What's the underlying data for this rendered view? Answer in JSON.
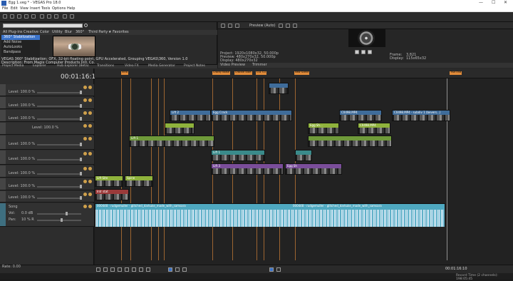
{
  "titlebar": {
    "title": "Egg 1.veg * - VEGAS Pro 18.0",
    "min": "—",
    "max": "☐",
    "close": "✕"
  },
  "menu": [
    "File",
    "Edit",
    "View",
    "Insert",
    "Tools",
    "Options",
    "Help"
  ],
  "explorer": {
    "tabs": [
      "All Plug-ins",
      "Creative",
      "Color",
      "Utility",
      "Blur",
      "360°",
      "Third Party",
      "★ Favorites"
    ],
    "items": [
      "360° Stabilization",
      "Add Noise",
      "AutoLooks",
      "Bandpass"
    ],
    "description_1": "VEGAS 360° Stabilization: OFX, 32-bit floating point, GPU Accelerated, Grouping VEGAS\\360, Version 1.0",
    "description_2": "Description: From Magix Computer Products Intl. Co."
  },
  "bottom_tabs": [
    "Project Media",
    "Explorer",
    "Hub Explorer (Beta)",
    "Transitions",
    "Video FX",
    "Media Generator",
    "Project Notes"
  ],
  "preview": {
    "mode": "Preview (Auto)",
    "project": "Project:  1920x1080x32, 50.000p",
    "preview_line": "Preview:  480x270x32, 50.000p",
    "display": "Display:  480x270x32",
    "frame_label": "Frame:",
    "frame_value": "3,821",
    "display_label": "Display:",
    "display_value": "115x65x32",
    "tabs": [
      "Video Preview",
      "Trimmer"
    ]
  },
  "timecode": "00:01:16:10",
  "tracks": [
    {
      "level": "Level: 100.0 %"
    },
    {
      "level": "Level: 100.0 %"
    },
    {
      "level": "Level: 100.0 %"
    },
    {
      "level": "Level: 100.0 %"
    },
    {
      "level": "Level: 100.0 %"
    },
    {
      "level": "Level: 100.0 %"
    },
    {
      "level": "Level: 100.0 %"
    },
    {
      "level": "Level: 100.0 %"
    },
    {
      "level": "Level: 100.0 %"
    }
  ],
  "audio_track": {
    "name": "Song",
    "vol_label": "Vol:",
    "vol_value": "0.0 dB",
    "pan_label": "Pan:",
    "pan_value": "10 % R"
  },
  "markers": [
    "Intro",
    "Cracky Noise",
    "Crackle Start",
    "Cu1 Cu",
    "New Scene",
    "True End"
  ],
  "clips": [
    {
      "label": "Lift 2",
      "cls": "c-blue"
    },
    {
      "label": "Egg Crack",
      "cls": "c-blue"
    },
    {
      "label": "C0498.MP4",
      "cls": "c-blue"
    },
    {
      "label": "C0498.MP4 - subdiv 1 (bevers...)",
      "cls": "c-blue"
    },
    {
      "label": "Egg Sh...",
      "cls": "c-lime"
    },
    {
      "label": "C0498.MP4",
      "cls": "c-lime"
    },
    {
      "label": "Lift 1",
      "cls": "c-green"
    },
    {
      "label": "Lift 1",
      "cls": "c-teal"
    },
    {
      "label": "Lift 3",
      "cls": "c-purple"
    },
    {
      "label": "Egg Sh",
      "cls": "c-purple"
    },
    {
      "label": "Lift Site",
      "cls": "c-lime"
    },
    {
      "label": "Spine",
      "cls": "c-lime"
    },
    {
      "label": "Intr stat",
      "cls": "c-red"
    }
  ],
  "audio_clips": [
    "000448 - rudgemuller - glitched_darkuke_made_with_samsara",
    "000448 - rudgemuller - glitched_darkuke_made_with_samsara"
  ],
  "transport": {
    "rate": "Rate: 0.00",
    "timecode": "00:01:16:10"
  },
  "status": {
    "record": "Record Time (2 channels): 198:05:45"
  }
}
